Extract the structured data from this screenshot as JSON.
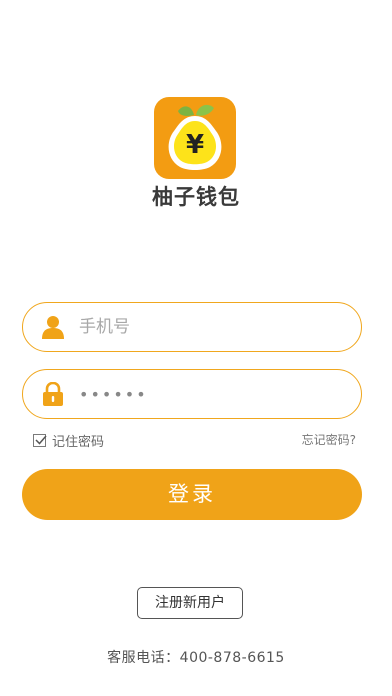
{
  "app": {
    "name": "柚子钱包",
    "logo_symbol": "¥",
    "icon": "pomelo-coin-logo"
  },
  "colors": {
    "accent": "#f0a318",
    "field_border": "#f0a71e",
    "logo_background": "#f39c12",
    "logo_fruit": "#fde31a",
    "leaf": "#7cb342"
  },
  "login": {
    "phone": {
      "placeholder": "手机号",
      "value": "",
      "icon": "user-icon"
    },
    "password": {
      "placeholder": "",
      "value": "••••••",
      "icon": "lock-icon"
    },
    "remember": {
      "label": "记住密码",
      "checked": true
    },
    "forgot_label": "忘记密码?",
    "submit_label": "登录"
  },
  "register_label": "注册新用户",
  "hotline": "客服电话：400-878-6615"
}
